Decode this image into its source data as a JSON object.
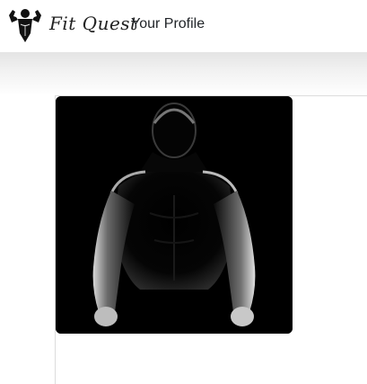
{
  "navbar": {
    "logo_icon": "flexing-bodybuilder-icon",
    "brand": "Fit Quest",
    "links": [
      {
        "label": "Your Profile"
      }
    ]
  },
  "profile": {
    "image_icon": "muscular-man-silhouette-photo"
  }
}
